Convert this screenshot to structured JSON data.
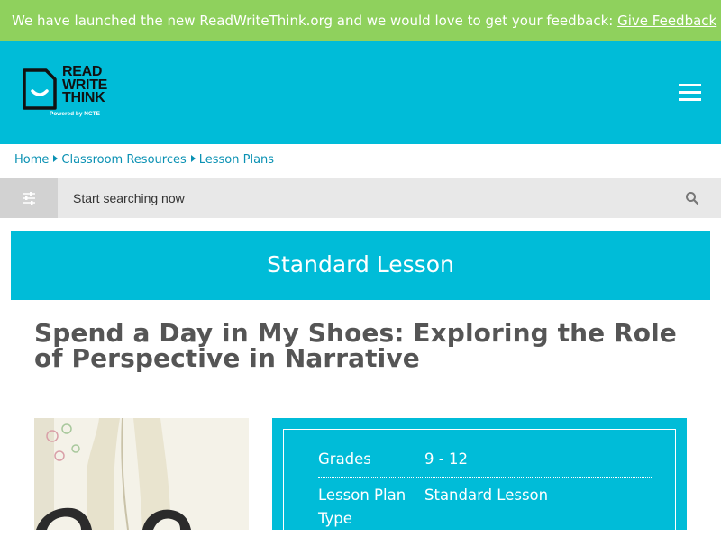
{
  "banner": {
    "message": "We have launched the new ReadWriteThink.org and we would love to get your feedback: ",
    "link": "Give Feedback"
  },
  "logo": {
    "line1": "READ",
    "line2": "WRITE",
    "line3": "THINK",
    "sub": "Powered by NCTE"
  },
  "breadcrumb": [
    "Home",
    "Classroom Resources",
    "Lesson Plans"
  ],
  "search": {
    "placeholder": "Start searching now"
  },
  "lesson_type_banner": "Standard Lesson",
  "title": "Spend a Day in My Shoes: Exploring the Role of Perspective in Narrative",
  "info": {
    "grades_label": "Grades",
    "grades_value": "9 - 12",
    "type_label": "Lesson Plan Type",
    "type_value": "Standard Lesson"
  },
  "colors": {
    "banner": "#8fd15d",
    "brand": "#00bcd8",
    "link": "#0a91b3",
    "title": "#555555"
  }
}
